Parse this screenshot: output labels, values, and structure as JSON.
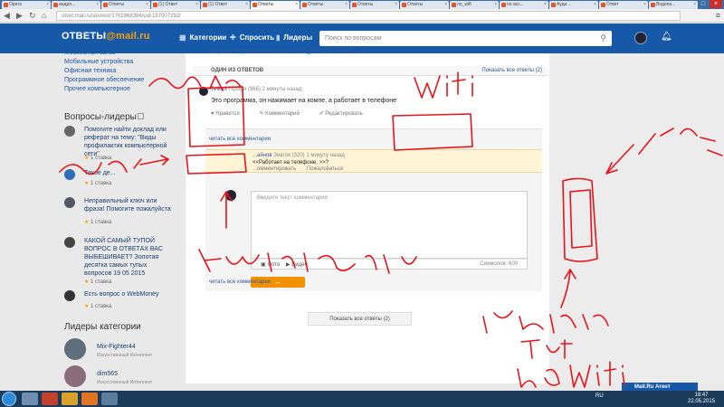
{
  "browser": {
    "tabs": [
      {
        "label": "Opera"
      },
      {
        "label": "андро..."
      },
      {
        "label": "Ответы"
      },
      {
        "label": "(1) Ответ"
      },
      {
        "label": "(1) Ответ"
      },
      {
        "label": "Ответы"
      },
      {
        "label": "Ответы"
      },
      {
        "label": "Ответы"
      },
      {
        "label": "Ответы"
      },
      {
        "label": "no_wifi"
      },
      {
        "label": "no acc..."
      },
      {
        "label": "Ауди..."
      },
      {
        "label": "Ответ"
      },
      {
        "label": "Водопа..."
      }
    ],
    "url": "otvet.mail.ru/answer/1762868384/cid-187007292/"
  },
  "header": {
    "logo_text": "ОТВЕТЫ",
    "logo_brand": "@mail.ru",
    "nav_categories": "Категории",
    "nav_ask": "Спросить",
    "nav_leaders": "Лидеры",
    "search_placeholder": "Поиск по вопросам"
  },
  "sidebar": {
    "categories": [
      "Мобильная связь",
      "Мобильные устройства",
      "Офисная техника",
      "Программное обеспечение",
      "Прочее компьютерное"
    ],
    "leaders_questions_title": "Вопросы-лидеры",
    "questions": [
      {
        "text": "Помогите найти доклад или реферат на тему: \"Виды профилактик компьютерной сети\"",
        "meta": "1 ставка"
      },
      {
        "text": "Такое де...",
        "meta": "1 ставка"
      },
      {
        "text": "Неправильный ключ или фраза! Помогите пожалуйста",
        "meta": "1 ставка"
      },
      {
        "text": "КАКОЙ САМЫЙ ТУПОЙ ВОПРОС В ОТВЕТАХ ВАС ВЫБЕШИВАЕТ? Золотая десятка самых тупых вопросов 19 05 2015",
        "meta": "1 ставка"
      },
      {
        "text": "Есть вопрос о WebMoney",
        "meta": "1 ставка"
      }
    ],
    "category_leaders_title": "Лидеры категории",
    "leaders": [
      {
        "name": "Mix-Fighter44",
        "role": "Искусственный Интеллект"
      },
      {
        "name": "dim565",
        "role": "Искусственный Интеллект"
      }
    ]
  },
  "main": {
    "youtube_link": "http://www.youtube.com/watch?v=_lV3nzNiRWw?",
    "answers_label": "ОДИН ИЗ ОТВЕТОВ",
    "show_all_top": "Показать все ответы (2)",
    "answer": {
      "author": "TeIkeX",
      "author_meta": "Профи (965) 2 минуты назад",
      "text": "Это программа, он нажимает на компе, а работает в телефоне",
      "like": "Нравится",
      "comment": "Комментарий",
      "edit": "Редактировать"
    },
    "show_comments": "читать все комментарии",
    "comment": {
      "author": "...айнов",
      "author_meta": "Знаток (320) 1 минуту назад",
      "text": "<<Работает на телефоне. >>?",
      "reply": "...омментировать",
      "report": "Пожаловаться"
    },
    "comment_placeholder": "Введите текст комментария",
    "photo": "Фото",
    "video": "Видео",
    "chars": "Символов: 600",
    "submit": "...",
    "show_comments_bottom": "читать все комментарии",
    "show_all_bottom": "Показать все ответы (2)"
  },
  "agent": {
    "label": "Mail.Ru Агент"
  },
  "taskbar": {
    "lang": "RU",
    "time": "18:47",
    "date": "22.05.2015"
  },
  "handwriting": {
    "colors": {
      "ink": "#e8141a"
    }
  }
}
